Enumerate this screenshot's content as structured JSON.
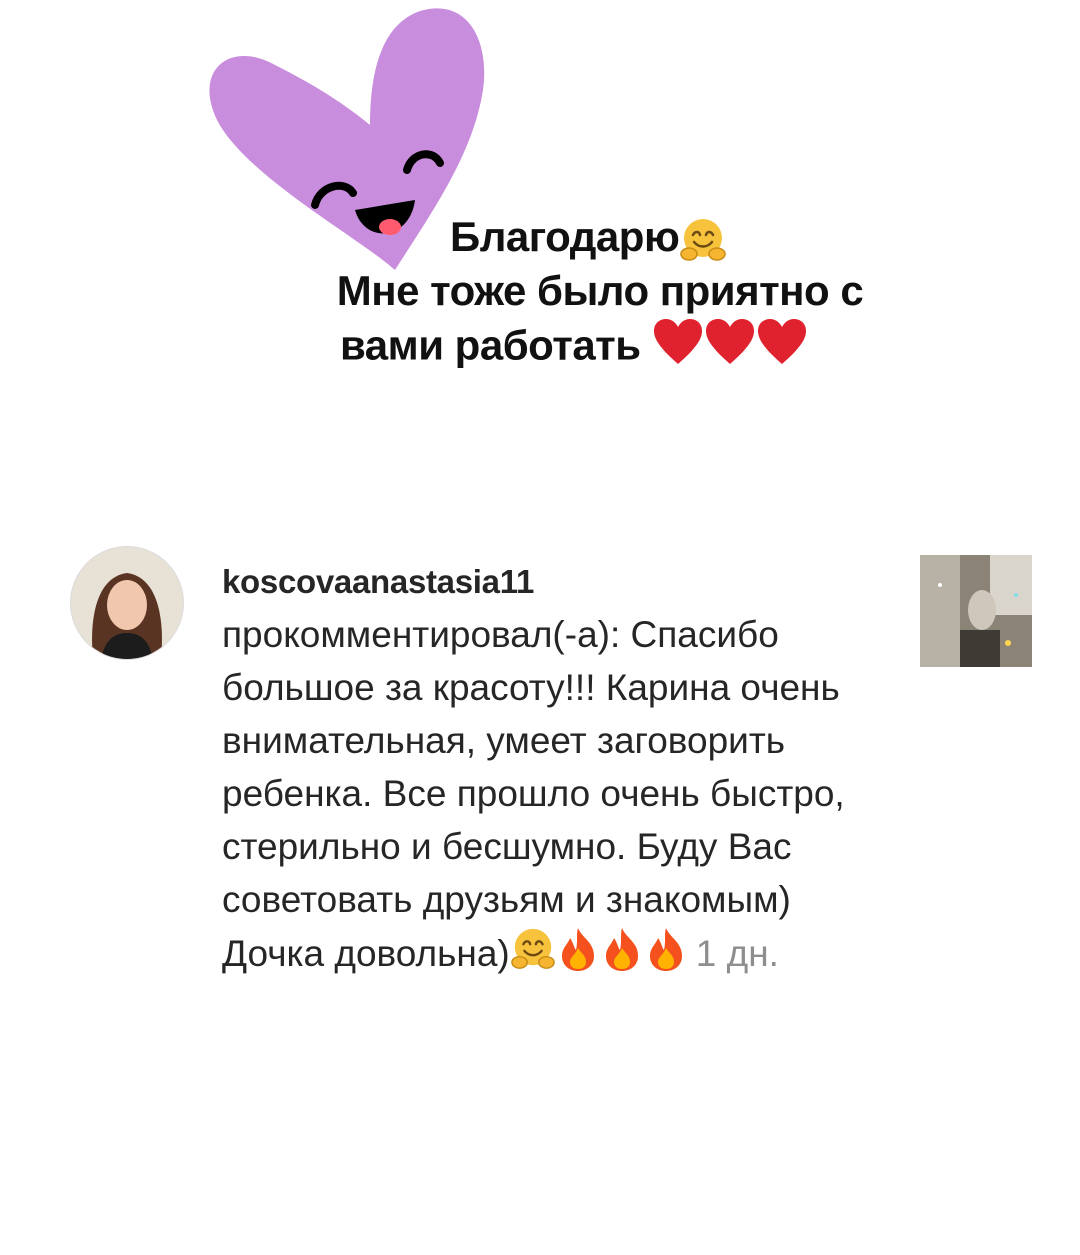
{
  "reply": {
    "line1": "Благодарю",
    "line2": "Мне тоже было приятно с",
    "line3": "вами работать"
  },
  "sticker": {
    "icon": "smiling-heart-sticker",
    "color": "#c98ddd"
  },
  "notification": {
    "username": "koscovaanastasia11",
    "action": "прокомментировал(-а): ",
    "comment": "Спасибо большое за красоту!!! Карина очень внимательная, умеет заговорить ребенка. Все прошло очень быстро, стерильно и бесшумно. Буду Вас советовать друзьям и знакомым) Дочка довольна)",
    "time": "1 дн.",
    "avatar_icon": "user-avatar",
    "thumbnail_icon": "post-thumbnail"
  },
  "colors": {
    "heart_red": "#e0222f",
    "fire_orange": "#f4511e",
    "hug_yellow": "#f7c23c",
    "time_gray": "#8e8e8e"
  }
}
